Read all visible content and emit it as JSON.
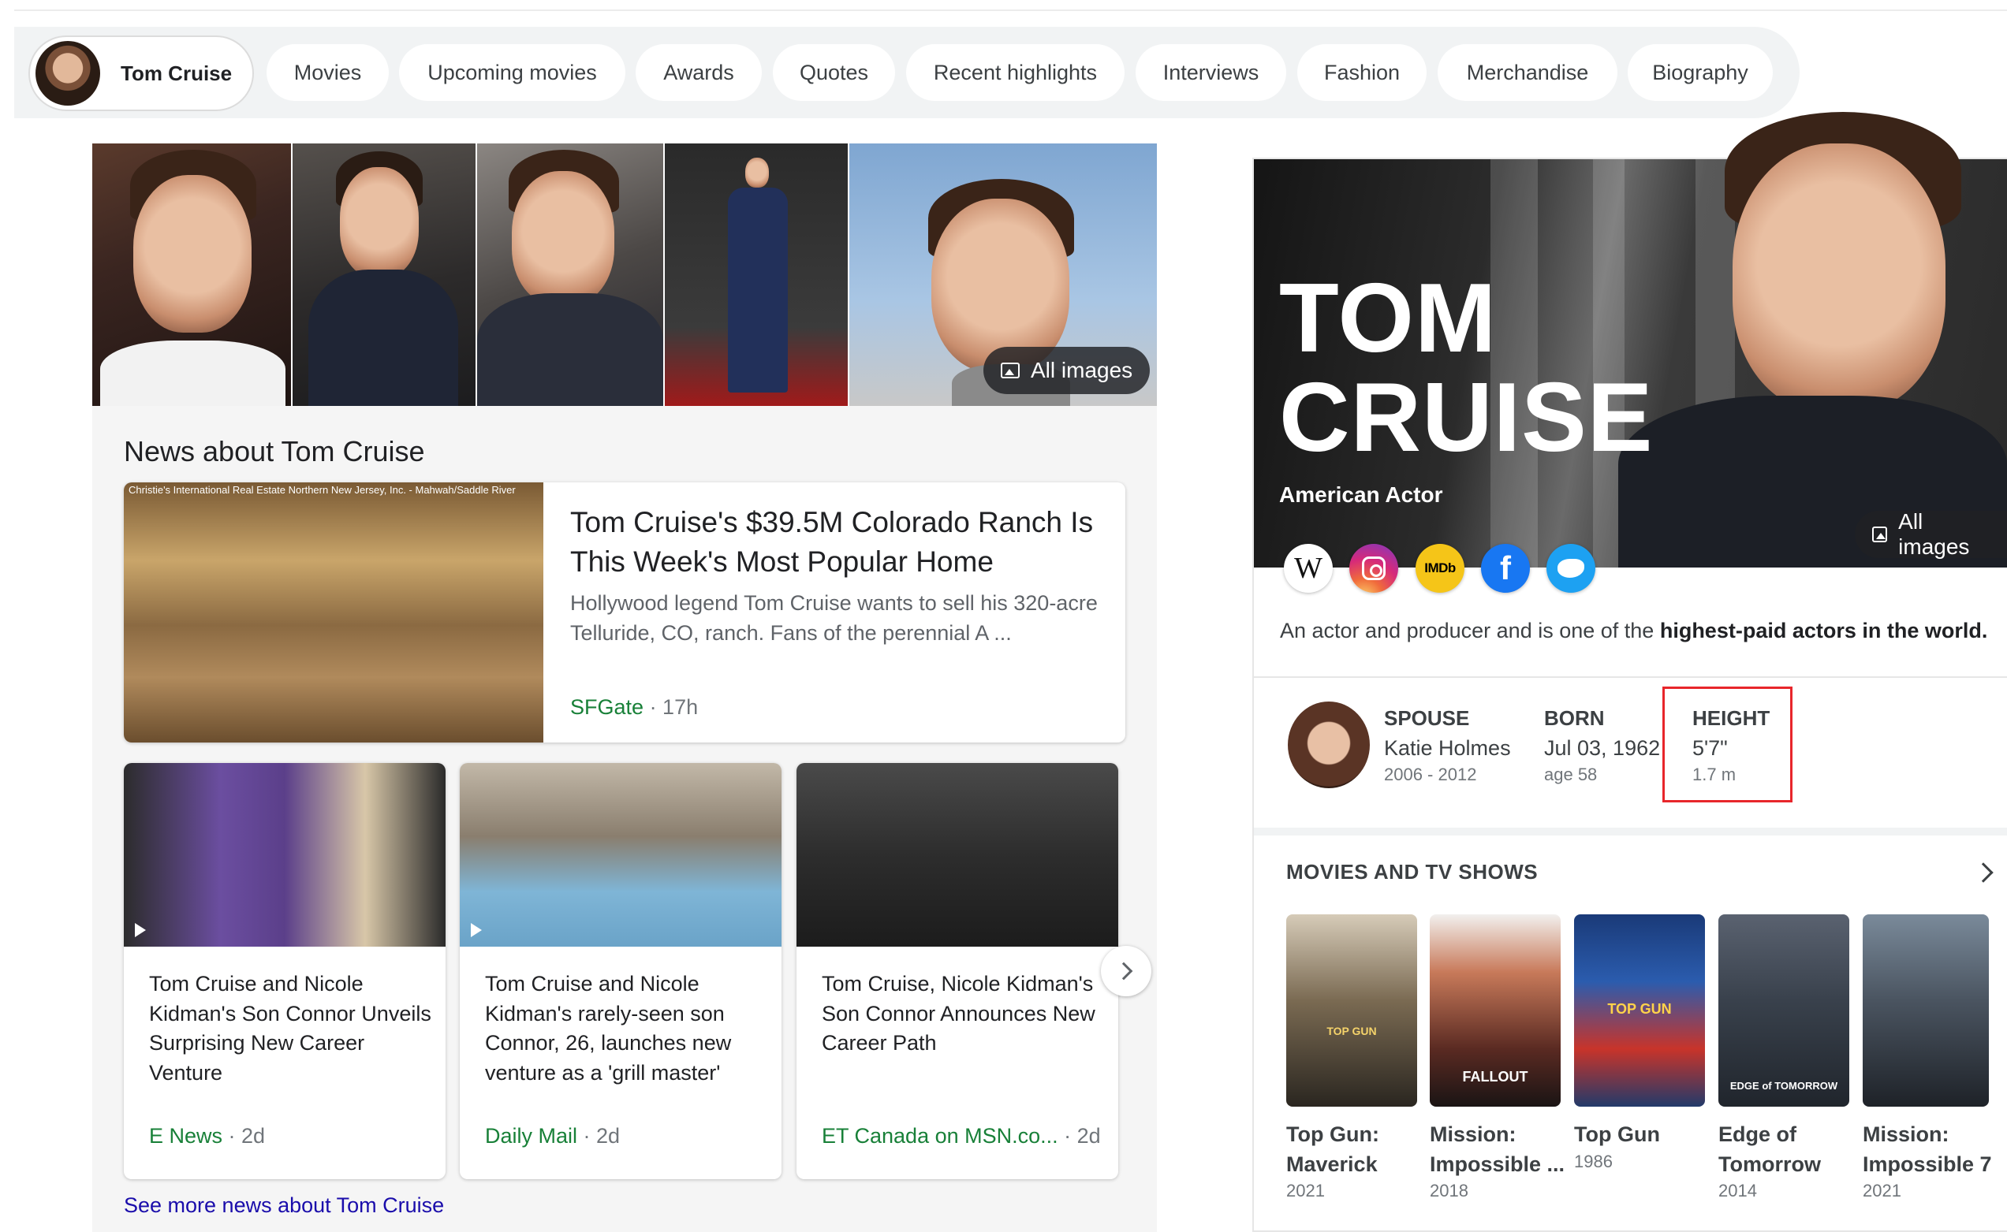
{
  "topbar": {
    "entity": "Tom Cruise",
    "chips": [
      "Movies",
      "Upcoming movies",
      "Awards",
      "Quotes",
      "Recent highlights",
      "Interviews",
      "Fashion",
      "Merchandise",
      "Biography"
    ]
  },
  "images": {
    "all_images_label": "All images"
  },
  "news": {
    "heading": "News about Tom Cruise",
    "main": {
      "image_caption": "Christie's International Real Estate Northern New Jersey, Inc. - Mahwah/Saddle River",
      "title": "Tom Cruise's $39.5M Colorado Ranch Is This Week's Most Popular Home",
      "snippet": "Hollywood legend Tom Cruise wants to sell his 320-acre Telluride, CO, ranch. Fans of the perennial A ...",
      "source": "SFGate",
      "age": "· 17h"
    },
    "cards": [
      {
        "title": "Tom Cruise and Nicole Kidman's Son Connor Unveils Surprising New Career Venture",
        "source": "E News",
        "age": "· 2d"
      },
      {
        "title": "Tom Cruise and Nicole Kidman's rarely-seen son Connor, 26, launches new venture as a 'grill master'",
        "source": "Daily Mail",
        "age": "· 2d"
      },
      {
        "title": "Tom Cruise, Nicole Kidman's Son Connor Announces New Career Path",
        "source": "ET Canada on MSN.co...",
        "age": "· 2d"
      }
    ],
    "see_more": "See more news about Tom Cruise"
  },
  "panel": {
    "name_line1": "TOM",
    "name_line2": "CRUISE",
    "subtitle": "American Actor",
    "all_images_label": "All images",
    "social": {
      "wiki": "W",
      "imdb": "IMDb",
      "facebook": "f"
    },
    "description_pre": "An actor and producer and is one of the ",
    "description_bold": "highest-paid actors in the world.",
    "facts": {
      "spouse": {
        "label": "SPOUSE",
        "value": "Katie Holmes",
        "sub": "2006 - 2012"
      },
      "born": {
        "label": "BORN",
        "value": "Jul 03, 1962",
        "sub": "age 58"
      },
      "height": {
        "label": "HEIGHT",
        "value": "5'7\"",
        "sub": "1.7 m"
      }
    },
    "movies_heading": "MOVIES AND TV SHOWS",
    "movies": [
      {
        "line1": "Top Gun:",
        "line2": "Maverick",
        "year": "2021",
        "poster_text": "TOP GUN"
      },
      {
        "line1": "Mission:",
        "line2": "Impossible ...",
        "year": "2018",
        "poster_text": "FALLOUT"
      },
      {
        "line1": "Top Gun",
        "line2": "",
        "year": "1986",
        "poster_text": "TOP GUN"
      },
      {
        "line1": "Edge of",
        "line2": "Tomorrow",
        "year": "2014",
        "poster_text": "EDGE of TOMORROW"
      },
      {
        "line1": "Mission:",
        "line2": "Impossible 7",
        "year": "2021",
        "poster_text": ""
      }
    ]
  },
  "colors": {
    "link": "#1a0dab",
    "source_green": "#188038",
    "highlight_red": "#e8262b",
    "chip_bg": "#f1f3f4"
  }
}
